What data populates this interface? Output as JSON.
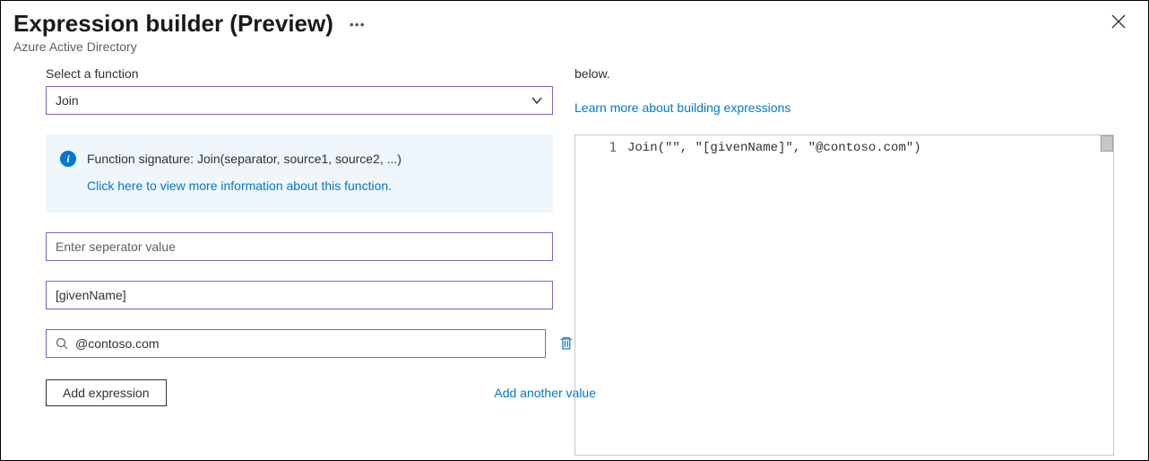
{
  "header": {
    "title": "Expression builder (Preview)",
    "subtitle": "Azure Active Directory"
  },
  "left": {
    "select_label": "Select a function",
    "select_value": "Join",
    "info_signature": "Function signature: Join(separator, source1, source2, ...)",
    "info_link": "Click here to view more information about this function.",
    "separator_placeholder": "Enter seperator value",
    "source1_value": "[givenName]",
    "source2_value": "@contoso.com",
    "add_expression_label": "Add expression",
    "add_value_label": "Add another value"
  },
  "right": {
    "below_text": "below.",
    "learn_link": "Learn more about building expressions",
    "code_line_num": "1",
    "code_text": "Join(\"\", \"[givenName]\", \"@contoso.com\")"
  }
}
